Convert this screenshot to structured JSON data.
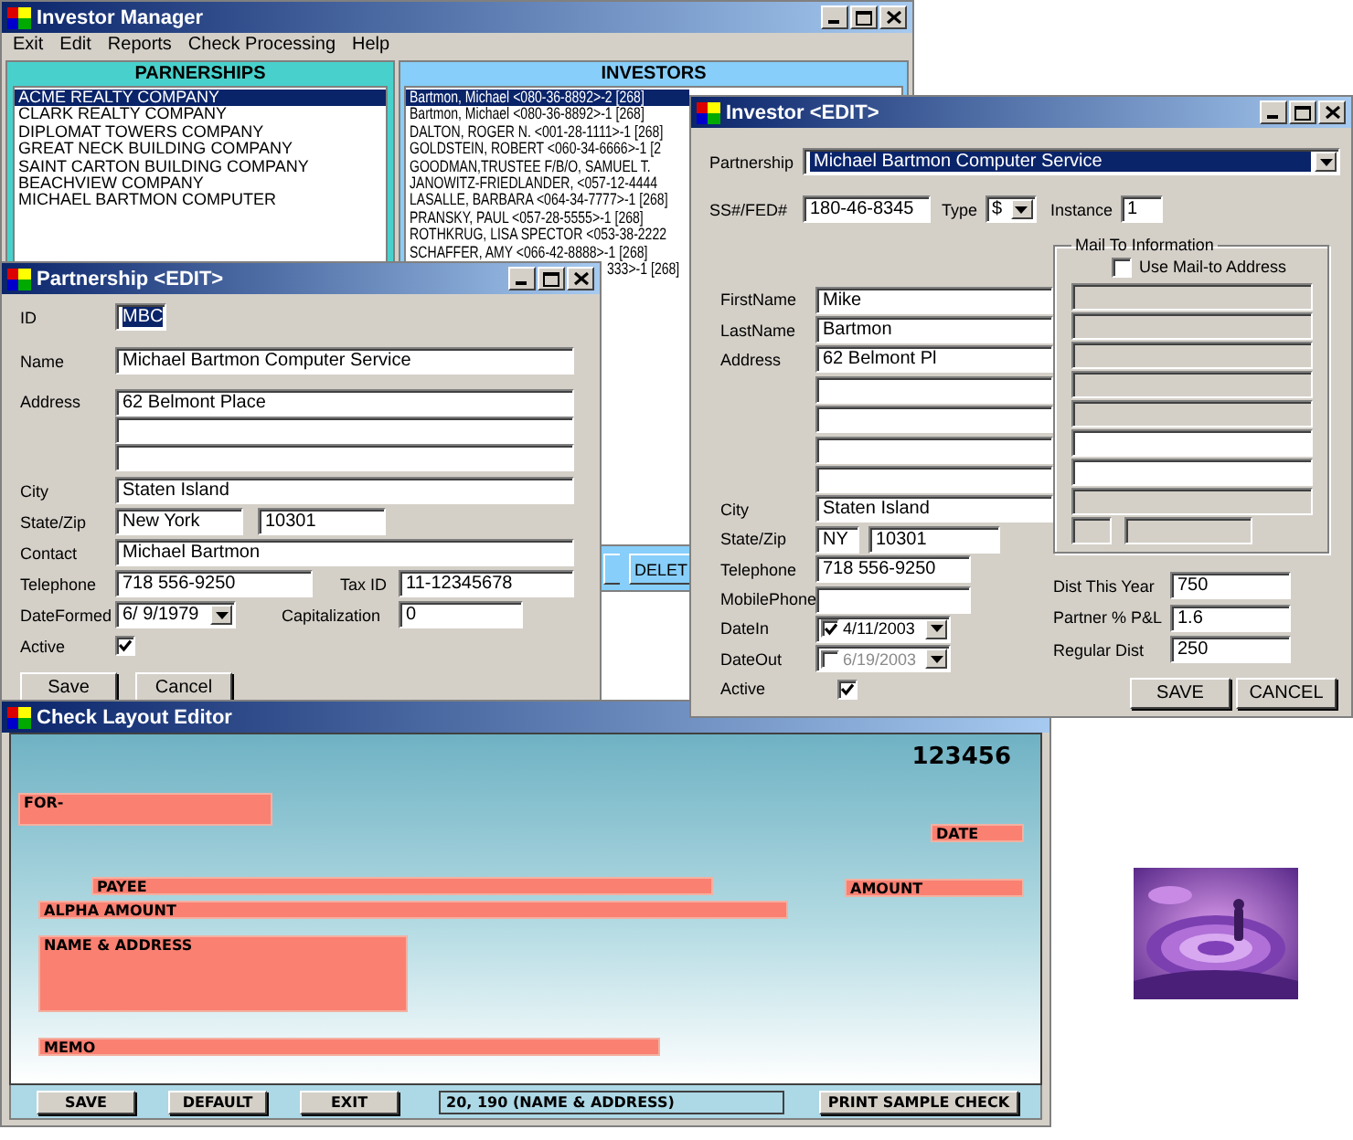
{
  "main_window": {
    "title": "Investor Manager",
    "menu": [
      "Exit",
      "Edit",
      "Reports",
      "Check Processing",
      "Help"
    ],
    "partnerships": {
      "heading": "PARNERSHIPS",
      "items": [
        {
          "label": "ACME REALTY COMPANY",
          "selected": true
        },
        {
          "label": "CLARK REALTY COMPANY",
          "selected": false
        },
        {
          "label": "DIPLOMAT TOWERS COMPANY",
          "selected": false
        },
        {
          "label": "GREAT NECK BUILDING COMPANY",
          "selected": false
        },
        {
          "label": "SAINT CARTON BUILDING COMPANY",
          "selected": false
        },
        {
          "label": "BEACHVIEW COMPANY",
          "selected": false
        },
        {
          "label": "MICHAEL BARTMON COMPUTER",
          "selected": false
        }
      ]
    },
    "investors": {
      "heading": "INVESTORS",
      "items": [
        {
          "label": "Bartmon, Michael <080-36-8892>-2 [268]",
          "selected": true
        },
        {
          "label": "Bartmon, Michael <080-36-8892>-1 [268]",
          "selected": false
        },
        {
          "label": "DALTON, ROGER N. <001-28-1111>-1 [268]",
          "selected": false
        },
        {
          "label": "GOLDSTEIN, ROBERT <060-34-6666>-1 [2",
          "selected": false
        },
        {
          "label": "GOODMAN,TRUSTEE F/B/O, SAMUEL T.",
          "selected": false
        },
        {
          "label": "JANOWITZ-FRIEDLANDER, <057-12-4444",
          "selected": false
        },
        {
          "label": "LASALLE, BARBARA <064-34-7777>-1 [268]",
          "selected": false
        },
        {
          "label": "PRANSKY, PAUL <057-28-5555>-1 [268]",
          "selected": false
        },
        {
          "label": "ROTHKRUG, LISA SPECTOR <053-38-2222",
          "selected": false
        },
        {
          "label": "SCHAFFER, AMY <066-42-8888>-1 [268]",
          "selected": false
        },
        {
          "label": "333>-1 [268]",
          "selected": false,
          "kind": "partial"
        }
      ]
    },
    "buttons": [
      "DELET"
    ]
  },
  "partnership_window": {
    "title": "Partnership <EDIT>",
    "id": {
      "label": "ID",
      "value": "MBC"
    },
    "name": {
      "label": "Name",
      "value": "Michael Bartmon Computer Service"
    },
    "address": {
      "label": "Address",
      "value": "62 Belmont Place"
    },
    "city": {
      "label": "City",
      "value": "Staten Island"
    },
    "state_zip": {
      "label": "State/Zip",
      "state": "New York",
      "zip": "10301"
    },
    "contact": {
      "label": "Contact",
      "value": "Michael Bartmon"
    },
    "telephone": {
      "label": "Telephone",
      "value": "718 556-9250"
    },
    "tax_id": {
      "label": "Tax ID",
      "value": "11-12345678"
    },
    "date_formed": {
      "label": "DateFormed",
      "value": "6/  9/1979"
    },
    "capitalization": {
      "label": "Capitalization",
      "value": "0"
    },
    "active": {
      "label": "Active",
      "checked": true
    },
    "buttons": [
      "Save",
      "Cancel"
    ]
  },
  "investor_window": {
    "title": "Investor <EDIT>",
    "partnership": {
      "label": "Partnership",
      "value": "Michael Bartmon Computer Service"
    },
    "ssn": {
      "label": "SS#/FED#",
      "value": "180-46-8345"
    },
    "type": {
      "label": "Type",
      "value": "$"
    },
    "instance": {
      "label": "Instance",
      "value": "1"
    },
    "first_name": {
      "label": "FirstName",
      "value": "Mike"
    },
    "last_name": {
      "label": "LastName",
      "value": "Bartmon"
    },
    "address": {
      "label": "Address",
      "value": "62 Belmont Pl"
    },
    "city": {
      "label": "City",
      "value": "Staten Island"
    },
    "state_zip": {
      "label": "State/Zip",
      "state": "NY",
      "zip": "10301"
    },
    "telephone": {
      "label": "Telephone",
      "value": "718 556-9250"
    },
    "mobile_phone": {
      "label": "MobilePhone"
    },
    "date_in": {
      "label": "DateIn",
      "value": "4/11/2003",
      "checked": true
    },
    "date_out": {
      "label": "DateOut",
      "value": "6/19/2003",
      "checked": false
    },
    "active": {
      "label": "Active",
      "checked": true
    },
    "mail_to": {
      "title": "Mail To Information",
      "use_label": "Use Mail-to Address",
      "checked": false,
      "lines": [
        {
          "disabled": true
        },
        {
          "disabled": true
        },
        {
          "disabled": true
        },
        {
          "disabled": true
        },
        {
          "disabled": true
        },
        {
          "disabled": false
        },
        {
          "disabled": false
        },
        {
          "disabled": true
        }
      ]
    },
    "dist_this_year": {
      "label": "Dist This Year",
      "value": "750"
    },
    "partner_pl": {
      "label": "Partner % P&L",
      "value": "1.6"
    },
    "regular_dist": {
      "label": "Regular Dist",
      "value": "250"
    },
    "buttons": [
      "SAVE",
      "CANCEL"
    ]
  },
  "check_editor": {
    "title": "Check Layout Editor",
    "check_number": "123456",
    "fields": [
      {
        "label": "FOR-"
      },
      {
        "label": "DATE"
      },
      {
        "label": "PAYEE"
      },
      {
        "label": "AMOUNT"
      },
      {
        "label": "ALPHA AMOUNT"
      },
      {
        "label": "NAME & ADDRESS"
      },
      {
        "label": "MEMO"
      }
    ],
    "buttons": [
      "SAVE",
      "DEFAULT",
      "EXIT"
    ],
    "status": "20, 190 (NAME & ADDRESS)",
    "print_button": "PRINT SAMPLE CHECK"
  }
}
